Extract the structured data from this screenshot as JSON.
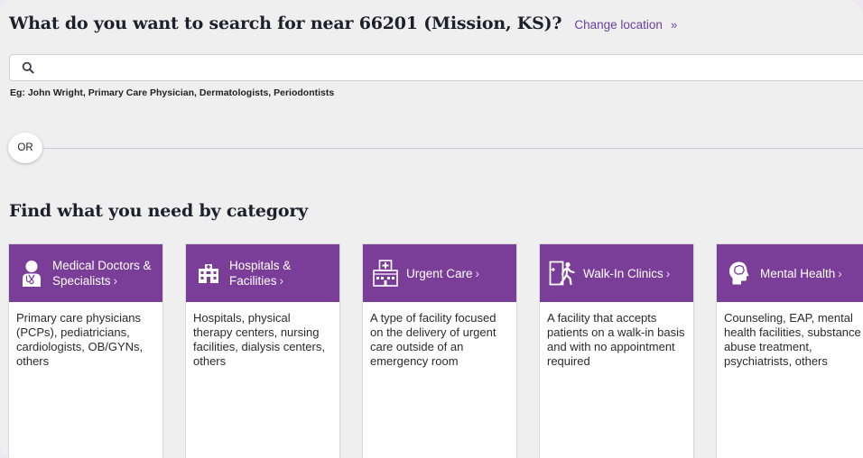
{
  "header": {
    "title": "What do you want to search for near 66201 (Mission, KS)?",
    "change_location": "Change location",
    "change_chevron": "»"
  },
  "search": {
    "value": "",
    "placeholder": "",
    "hint": "Eg: John Wright, Primary Care Physician, Dermatologists, Periodontists"
  },
  "divider": {
    "or_label": "OR"
  },
  "categories": {
    "title": "Find what you need by category",
    "chevron": "›",
    "accent_color": "#7b3e98",
    "items": [
      {
        "label": "Medical Doctors & Specialists",
        "icon": "doctor-icon",
        "description": "Primary care physicians (PCPs), pediatricians, cardiologists, OB/GYNs, others"
      },
      {
        "label": "Hospitals & Facilities",
        "icon": "hospital-building-icon",
        "description": "Hospitals, physical therapy centers, nursing facilities, dialysis centers, others"
      },
      {
        "label": "Urgent Care",
        "icon": "urgent-care-building-icon",
        "description": "A type of facility focused on the delivery of urgent care outside of an emergency room"
      },
      {
        "label": "Walk-In Clinics",
        "icon": "walk-in-door-icon",
        "description": "A facility that accepts patients on a walk-in basis and with no appointment required"
      },
      {
        "label": "Mental Health",
        "icon": "head-brain-icon",
        "description": "Counseling, EAP, mental health facilities, substance abuse treatment, psychiatrists, others"
      }
    ]
  }
}
